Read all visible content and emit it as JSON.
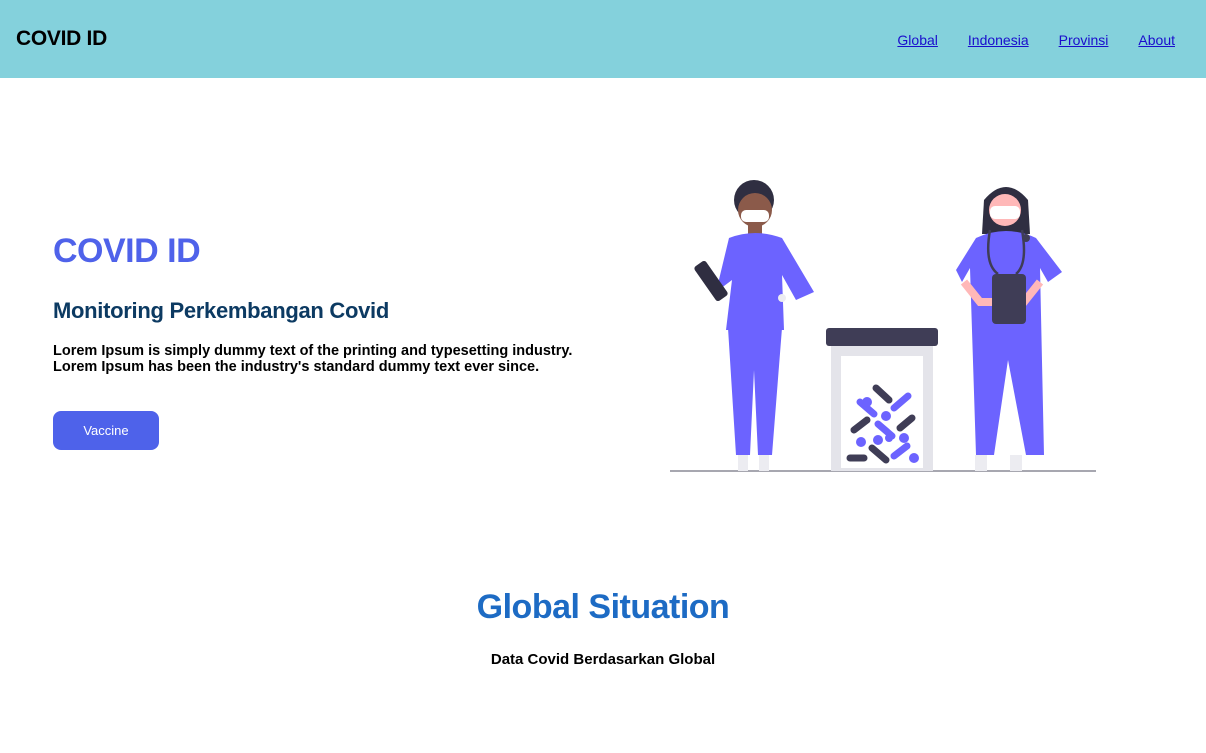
{
  "navbar": {
    "brand": "COVID ID",
    "links": [
      "Global",
      "Indonesia",
      "Provinsi",
      "About"
    ]
  },
  "hero": {
    "title": "COVID ID",
    "subtitle": "Monitoring Perkembangan Covid",
    "text": "Lorem Ipsum is simply dummy text of the printing and typesetting industry. Lorem Ipsum has been the industry's standard dummy text ever since.",
    "button_label": "Vaccine"
  },
  "global_section": {
    "title": "Global Situation",
    "subtitle": "Data Covid Berdasarkan Global"
  },
  "colors": {
    "navbar_bg": "#84d1dc",
    "accent": "#4e62ea",
    "dark_blue": "#0c3a62",
    "section_title": "#1d6bc4"
  }
}
